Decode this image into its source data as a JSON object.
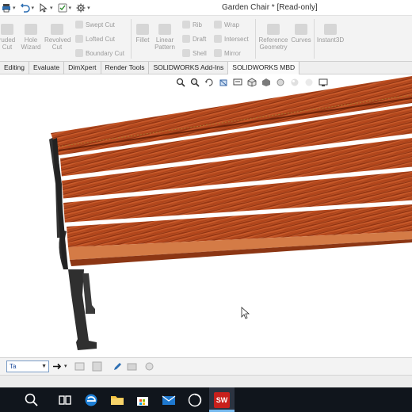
{
  "window": {
    "title": "Garden Chair * [Read-only]"
  },
  "ribbon": {
    "buttons": [
      {
        "label": "ruded Cut"
      },
      {
        "label": "Hole Wizard"
      },
      {
        "label": "Revolved Cut"
      },
      {
        "label": "Swept Cut"
      },
      {
        "label": "Lofted Cut"
      },
      {
        "label": "Boundary Cut"
      },
      {
        "label": "Fillet"
      },
      {
        "label": "Linear Pattern"
      },
      {
        "label": "Rib"
      },
      {
        "label": "Draft"
      },
      {
        "label": "Shell"
      },
      {
        "label": "Wrap"
      },
      {
        "label": "Intersect"
      },
      {
        "label": "Mirror"
      },
      {
        "label": "Reference Geometry"
      },
      {
        "label": "Curves"
      },
      {
        "label": "Instant3D"
      }
    ]
  },
  "tabs": [
    {
      "label": "Editing"
    },
    {
      "label": "Evaluate"
    },
    {
      "label": "DimXpert"
    },
    {
      "label": "Render Tools"
    },
    {
      "label": "SOLIDWORKS Add-Ins"
    },
    {
      "label": "SOLIDWORKS MBD"
    }
  ],
  "bottom_toolbar": {
    "selection_combo": "Ta"
  },
  "taskbar": {
    "solidworks_label": "SW"
  },
  "colors": {
    "wood": "#b8481c",
    "wood_dark": "#7e2a0d",
    "wood_light": "#d66a33",
    "frame": "#2f2f2f",
    "taskbar": "#10151c",
    "accent": "#1d63b5"
  }
}
